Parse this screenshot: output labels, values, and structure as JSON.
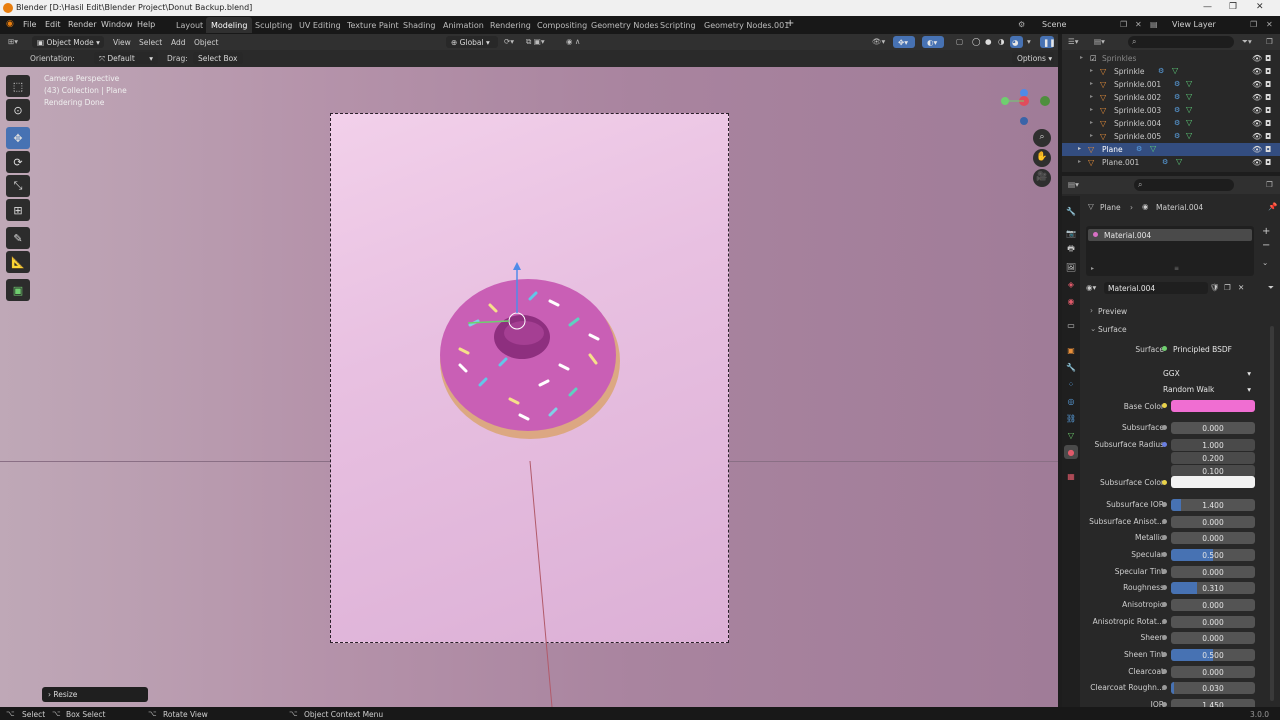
{
  "window": {
    "title": "Blender [D:\\Hasil Edit\\Blender Project\\Donut Backup.blend]"
  },
  "menu": [
    "File",
    "Edit",
    "Render",
    "Window",
    "Help"
  ],
  "workspaces": [
    "Layout",
    "Modeling",
    "Sculpting",
    "UV Editing",
    "Texture Paint",
    "Shading",
    "Animation",
    "Rendering",
    "Compositing",
    "Geometry Nodes",
    "Scripting",
    "Geometry Nodes.001"
  ],
  "active_workspace": "Modeling",
  "scene": {
    "label": "Scene",
    "view_layer": "View Layer"
  },
  "viewport_header": {
    "mode": "Object Mode",
    "menus": [
      "View",
      "Select",
      "Add",
      "Object"
    ],
    "transform": "Global"
  },
  "tool_settings": {
    "orientation_label": "Orientation:",
    "orientation": "Default",
    "drag_label": "Drag:",
    "drag": "Select Box",
    "options": "Options"
  },
  "overlay": {
    "line1": "Camera Perspective",
    "line2": "(43) Collection | Plane",
    "line3": "Rendering Done"
  },
  "last_op": "Resize",
  "outliner": {
    "rows": [
      {
        "name": "Sprinkles"
      },
      {
        "name": "Sprinkle"
      },
      {
        "name": "Sprinkle.001"
      },
      {
        "name": "Sprinkle.002"
      },
      {
        "name": "Sprinkle.003"
      },
      {
        "name": "Sprinkle.004"
      },
      {
        "name": "Sprinkle.005"
      },
      {
        "name": "Plane"
      },
      {
        "name": "Plane.001"
      }
    ]
  },
  "properties": {
    "breadcrumb_object": "Plane",
    "breadcrumb_material": "Material.004",
    "slot": "Material.004",
    "material_name": "Material.004",
    "panel_preview": "Preview",
    "panel_surface": "Surface",
    "surface_label": "Surface",
    "surface_value": "Principled BSDF",
    "distribution": "GGX",
    "subsurface_method": "Random Walk",
    "base_color_label": "Base Color",
    "base_color": "#f06ed2",
    "subsurface_color": "#f2f2f2",
    "fields": [
      {
        "label": "Subsurface",
        "value": "0.000",
        "fill": 0
      },
      {
        "label": "Subsurface Radius",
        "value": "1.000",
        "fill": 0
      },
      {
        "label": "",
        "value": "0.200",
        "fill": 0
      },
      {
        "label": "",
        "value": "0.100",
        "fill": 0
      },
      {
        "label": "Subsurface IOR",
        "value": "1.400",
        "fill": 0.12
      },
      {
        "label": "Subsurface Anisot...",
        "value": "0.000",
        "fill": 0
      },
      {
        "label": "Metallic",
        "value": "0.000",
        "fill": 0
      },
      {
        "label": "Specular",
        "value": "0.500",
        "fill": 0.5
      },
      {
        "label": "Specular Tint",
        "value": "0.000",
        "fill": 0
      },
      {
        "label": "Roughness",
        "value": "0.310",
        "fill": 0.31
      },
      {
        "label": "Anisotropic",
        "value": "0.000",
        "fill": 0
      },
      {
        "label": "Anisotropic Rotat...",
        "value": "0.000",
        "fill": 0
      },
      {
        "label": "Sheen",
        "value": "0.000",
        "fill": 0
      },
      {
        "label": "Sheen Tint",
        "value": "0.500",
        "fill": 0.5
      },
      {
        "label": "Clearcoat",
        "value": "0.000",
        "fill": 0
      },
      {
        "label": "Clearcoat Roughn...",
        "value": "0.030",
        "fill": 0.03
      },
      {
        "label": "IOR",
        "value": "1.450",
        "fill": 0
      }
    ],
    "subsurface_color_label": "Subsurface Color"
  },
  "status": {
    "select": "Select",
    "box_select": "Box Select",
    "rotate": "Rotate View",
    "context": "Object Context Menu",
    "version": "3.0.0"
  }
}
